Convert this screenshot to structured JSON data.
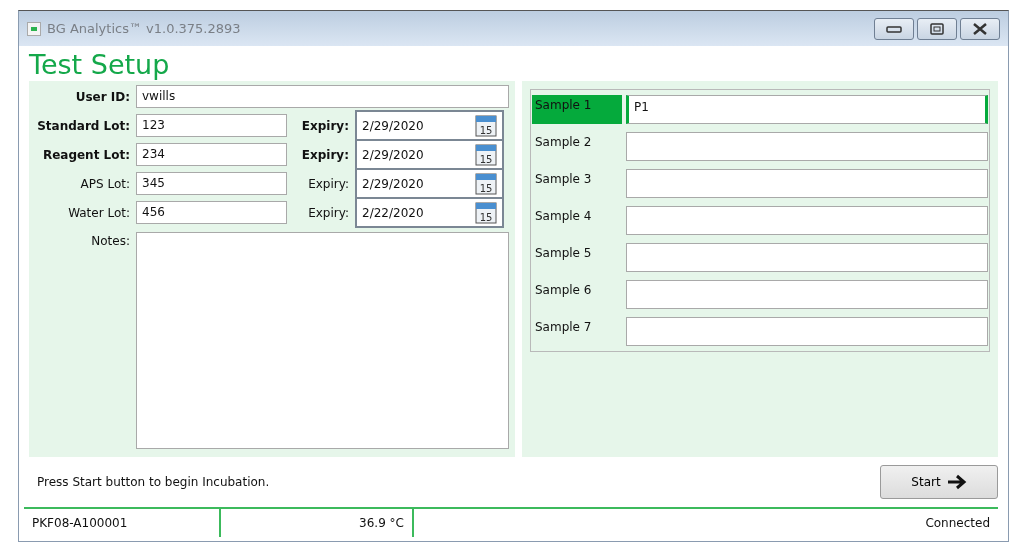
{
  "window": {
    "title": "BG Analytics™ v1.0.375.2893"
  },
  "page_title": "Test Setup",
  "user": {
    "label": "User ID:",
    "value": "vwills"
  },
  "lots": [
    {
      "label": "Standard Lot:",
      "value": "123",
      "expiry_label": "Expiry:",
      "expiry": "2/29/2020",
      "calendar_day": "15",
      "emphasized": true
    },
    {
      "label": "Reagent Lot:",
      "value": "234",
      "expiry_label": "Expiry:",
      "expiry": "2/29/2020",
      "calendar_day": "15",
      "emphasized": true
    },
    {
      "label": "APS Lot:",
      "value": "345",
      "expiry_label": "Expiry:",
      "expiry": "2/29/2020",
      "calendar_day": "15",
      "emphasized": false
    },
    {
      "label": "Water Lot:",
      "value": "456",
      "expiry_label": "Expiry:",
      "expiry": "2/22/2020",
      "calendar_day": "15",
      "emphasized": false
    }
  ],
  "notes": {
    "label": "Notes:"
  },
  "samples": [
    {
      "label": "Sample 1",
      "value": "P1",
      "selected": true
    },
    {
      "label": "Sample 2",
      "selected": false
    },
    {
      "label": "Sample 3",
      "selected": false
    },
    {
      "label": "Sample 4",
      "selected": false
    },
    {
      "label": "Sample 5",
      "selected": false
    },
    {
      "label": "Sample 6",
      "selected": false
    },
    {
      "label": "Sample 7",
      "selected": false
    }
  ],
  "message": "Press Start button to begin Incubation.",
  "start_button": {
    "label": "Start"
  },
  "status_bar": {
    "device": "PKF08-A100001",
    "temperature": "36.9 °C",
    "connection": "Connected"
  }
}
